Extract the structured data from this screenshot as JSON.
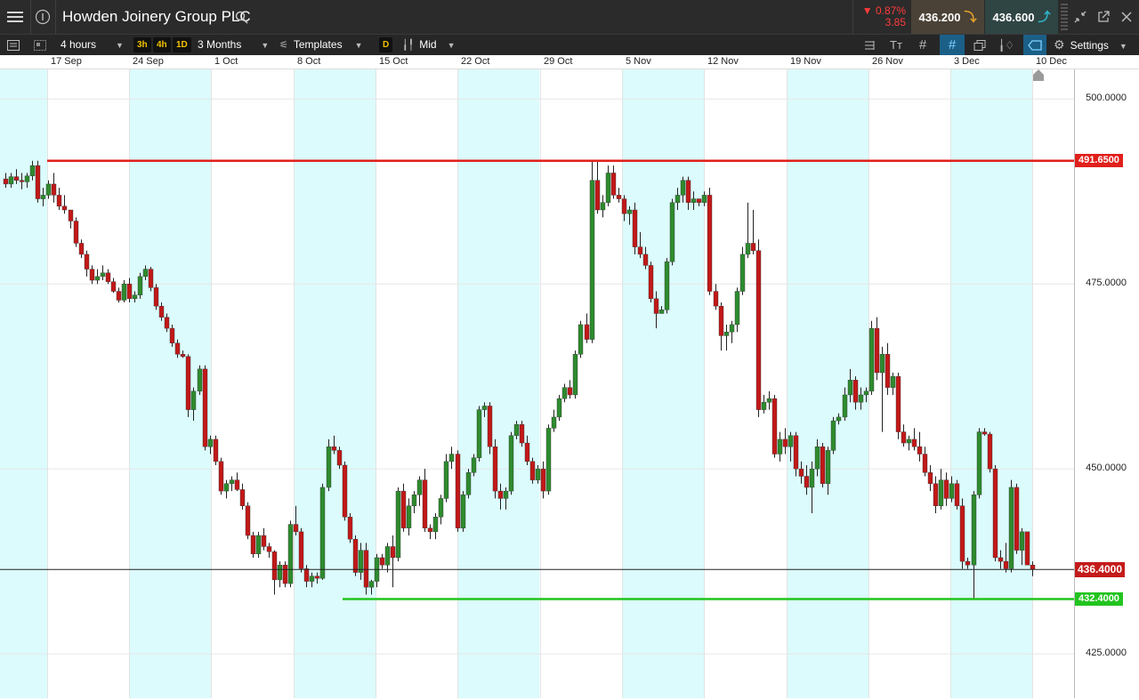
{
  "header": {
    "menu_icon": "hamburger-icon",
    "info_icon": "info-icon",
    "instrument_name": "Howden Joinery Group PLC",
    "change_percent": "▼ 0.87%",
    "change_value": "3.85",
    "sell_price": "436.200",
    "buy_price": "436.600",
    "window_icons": [
      "minimize-chart-icon",
      "popout-icon",
      "close-icon"
    ]
  },
  "toolbar": {
    "interval": "4 hours",
    "quick_intervals": [
      "3h",
      "4h",
      "1D"
    ],
    "range": "3 Months",
    "templates": "Templates",
    "d_badge": "D",
    "price_type": "Mid",
    "settings": "Settings"
  },
  "chart_data": {
    "type": "candlestick",
    "date_labels": [
      "17 Sep",
      "24 Sep",
      "1 Oct",
      "8 Oct",
      "15 Oct",
      "22 Oct",
      "29 Oct",
      "5 Nov",
      "12 Nov",
      "19 Nov",
      "26 Nov",
      "3 Dec",
      "10 Dec"
    ],
    "price_labels": [
      "500.0000",
      "475.0000",
      "450.0000",
      "425.0000"
    ],
    "price_ticks": [
      500,
      475,
      450,
      425
    ],
    "ylim": [
      419.0,
      504.0
    ],
    "resistance_line": {
      "value": 491.65,
      "label": "491.6500",
      "color": "#e0201b"
    },
    "support_line": {
      "value": 432.4,
      "label": "432.4000",
      "color": "#22c41f"
    },
    "current_price": {
      "value": 436.4,
      "label": "436.4000",
      "color": "#c41b1b"
    },
    "up_color": "#2e8b2e",
    "down_color": "#c21818",
    "shade_color": "#dcfbfc",
    "candles": [
      [
        489.2,
        490.0,
        488.0,
        488.5
      ],
      [
        488.5,
        490.0,
        488.0,
        489.5
      ],
      [
        489.5,
        490.5,
        488.5,
        489.0
      ],
      [
        489.0,
        490.0,
        487.8,
        488.8
      ],
      [
        488.8,
        490.0,
        488.0,
        489.6
      ],
      [
        489.6,
        491.65,
        489.0,
        491.0
      ],
      [
        491.0,
        491.65,
        486.0,
        486.5
      ],
      [
        486.5,
        488.0,
        485.5,
        487.0
      ],
      [
        487.0,
        489.0,
        486.5,
        488.5
      ],
      [
        488.5,
        490.0,
        486.0,
        487.0
      ],
      [
        487.0,
        488.0,
        485.0,
        485.5
      ],
      [
        485.5,
        487.0,
        484.5,
        485.0
      ],
      [
        485.0,
        484.5,
        482.5,
        483.5
      ],
      [
        483.5,
        484.0,
        480.0,
        480.5
      ],
      [
        480.5,
        481.0,
        478.5,
        479.0
      ],
      [
        479.0,
        479.5,
        476.0,
        477.0
      ],
      [
        477.0,
        477.5,
        475.0,
        475.5
      ],
      [
        475.5,
        477.0,
        475.0,
        476.0
      ],
      [
        476.0,
        477.5,
        475.5,
        476.5
      ],
      [
        476.5,
        477.0,
        475.0,
        475.3
      ],
      [
        475.3,
        475.8,
        473.8,
        474.0
      ],
      [
        474.0,
        474.5,
        472.5,
        472.8
      ],
      [
        472.8,
        475.5,
        472.5,
        475.0
      ],
      [
        475.0,
        475.8,
        472.5,
        473.0
      ],
      [
        473.0,
        474.0,
        472.5,
        473.5
      ],
      [
        473.5,
        476.5,
        473.0,
        476.0
      ],
      [
        476.0,
        477.5,
        475.5,
        477.0
      ],
      [
        477.0,
        477.3,
        474.0,
        474.5
      ],
      [
        474.5,
        475.0,
        471.5,
        472.0
      ],
      [
        472.0,
        472.5,
        470.0,
        470.5
      ],
      [
        470.5,
        471.0,
        468.5,
        469.0
      ],
      [
        469.0,
        469.5,
        466.5,
        467.0
      ],
      [
        467.0,
        467.5,
        465.0,
        465.5
      ],
      [
        465.5,
        466.0,
        465.0,
        465.2
      ],
      [
        465.2,
        465.5,
        457.0,
        458.0
      ],
      [
        458.0,
        461.0,
        456.5,
        460.5
      ],
      [
        460.5,
        464.0,
        460.0,
        463.5
      ],
      [
        463.5,
        464.0,
        452.5,
        453.0
      ],
      [
        453.0,
        454.5,
        452.0,
        454.0
      ],
      [
        454.0,
        454.5,
        450.5,
        451.0
      ],
      [
        451.0,
        451.5,
        446.5,
        447.0
      ],
      [
        447.0,
        448.5,
        446.0,
        448.0
      ],
      [
        448.0,
        449.0,
        447.0,
        448.5
      ],
      [
        448.5,
        449.5,
        447.0,
        447.2
      ],
      [
        447.2,
        448.0,
        444.5,
        445.0
      ],
      [
        445.0,
        445.5,
        440.5,
        441.0
      ],
      [
        441.0,
        441.5,
        438.0,
        438.5
      ],
      [
        438.5,
        441.5,
        438.0,
        441.0
      ],
      [
        441.0,
        442.0,
        439.0,
        439.5
      ],
      [
        439.5,
        440.0,
        438.0,
        438.8
      ],
      [
        438.8,
        439.0,
        433.0,
        435.0
      ],
      [
        435.0,
        437.5,
        434.0,
        437.0
      ],
      [
        437.0,
        437.5,
        434.0,
        434.5
      ],
      [
        434.5,
        443.0,
        434.0,
        442.5
      ],
      [
        442.5,
        445.0,
        441.0,
        441.5
      ],
      [
        441.5,
        442.0,
        436.0,
        436.5
      ],
      [
        436.5,
        437.0,
        434.0,
        434.8
      ],
      [
        434.8,
        436.0,
        434.0,
        435.5
      ],
      [
        435.5,
        436.0,
        434.5,
        435.2
      ],
      [
        435.2,
        448.0,
        435.0,
        447.5
      ],
      [
        447.5,
        454.0,
        447.0,
        453.0
      ],
      [
        453.0,
        454.5,
        452.0,
        452.5
      ],
      [
        452.5,
        453.0,
        450.0,
        450.5
      ],
      [
        450.5,
        451.0,
        443.0,
        443.5
      ],
      [
        443.5,
        444.0,
        440.0,
        440.5
      ],
      [
        440.5,
        441.0,
        435.5,
        436.0
      ],
      [
        436.0,
        440.0,
        435.0,
        439.0
      ],
      [
        439.0,
        440.0,
        433.0,
        434.0
      ],
      [
        434.0,
        435.0,
        433.0,
        434.8
      ],
      [
        434.8,
        438.5,
        434.0,
        438.0
      ],
      [
        438.0,
        438.5,
        436.5,
        437.0
      ],
      [
        437.0,
        440.0,
        436.0,
        439.5
      ],
      [
        439.5,
        441.0,
        434.0,
        438.0
      ],
      [
        438.0,
        447.5,
        437.5,
        447.0
      ],
      [
        447.0,
        448.0,
        441.5,
        442.0
      ],
      [
        442.0,
        446.0,
        441.0,
        445.0
      ],
      [
        445.0,
        447.0,
        444.0,
        446.5
      ],
      [
        446.5,
        449.0,
        445.0,
        448.5
      ],
      [
        448.5,
        450.0,
        441.5,
        442.0
      ],
      [
        442.0,
        442.5,
        440.5,
        441.5
      ],
      [
        441.5,
        444.0,
        440.5,
        443.5
      ],
      [
        443.5,
        446.5,
        442.5,
        446.0
      ],
      [
        446.0,
        452.0,
        445.5,
        451.0
      ],
      [
        451.0,
        453.0,
        450.0,
        452.0
      ],
      [
        452.0,
        452.5,
        441.5,
        442.0
      ],
      [
        442.0,
        447.0,
        441.5,
        446.5
      ],
      [
        446.5,
        450.0,
        446.0,
        449.5
      ],
      [
        449.5,
        452.0,
        449.0,
        451.5
      ],
      [
        451.5,
        458.5,
        451.0,
        458.0
      ],
      [
        458.0,
        459.0,
        457.0,
        458.5
      ],
      [
        458.5,
        459.0,
        452.0,
        453.0
      ],
      [
        453.0,
        454.0,
        446.0,
        447.0
      ],
      [
        447.0,
        448.0,
        444.5,
        446.0
      ],
      [
        446.0,
        447.5,
        444.5,
        447.0
      ],
      [
        447.0,
        455.0,
        446.5,
        454.5
      ],
      [
        454.5,
        456.5,
        454.0,
        456.0
      ],
      [
        456.0,
        456.5,
        453.0,
        453.5
      ],
      [
        453.5,
        454.5,
        450.5,
        451.0
      ],
      [
        451.0,
        451.5,
        448.0,
        448.5
      ],
      [
        448.5,
        450.5,
        448.0,
        450.0
      ],
      [
        450.0,
        451.0,
        446.0,
        447.0
      ],
      [
        447.0,
        456.0,
        446.5,
        455.5
      ],
      [
        455.5,
        458.0,
        455.0,
        457.0
      ],
      [
        457.0,
        460.0,
        456.5,
        459.5
      ],
      [
        459.5,
        461.5,
        459.0,
        461.0
      ],
      [
        461.0,
        462.0,
        459.5,
        460.0
      ],
      [
        460.0,
        466.0,
        459.5,
        465.5
      ],
      [
        465.5,
        470.0,
        465.0,
        469.5
      ],
      [
        469.5,
        471.0,
        467.0,
        467.5
      ],
      [
        467.5,
        491.5,
        467.0,
        489.0
      ],
      [
        489.0,
        491.5,
        484.5,
        485.0
      ],
      [
        485.0,
        487.0,
        484.0,
        486.0
      ],
      [
        486.0,
        491.0,
        485.5,
        490.0
      ],
      [
        490.0,
        491.0,
        486.5,
        487.0
      ],
      [
        487.0,
        488.0,
        486.0,
        486.5
      ],
      [
        486.5,
        487.0,
        483.5,
        484.5
      ],
      [
        484.5,
        485.5,
        483.0,
        485.0
      ],
      [
        485.0,
        486.0,
        479.0,
        480.0
      ],
      [
        480.0,
        482.0,
        478.5,
        479.0
      ],
      [
        479.0,
        480.0,
        477.0,
        477.5
      ],
      [
        477.5,
        478.0,
        472.5,
        473.0
      ],
      [
        473.0,
        474.0,
        469.0,
        471.0
      ],
      [
        471.0,
        472.0,
        471.0,
        471.5
      ],
      [
        471.5,
        478.5,
        471.0,
        478.0
      ],
      [
        478.0,
        486.5,
        477.5,
        486.0
      ],
      [
        486.0,
        488.0,
        485.0,
        487.0
      ],
      [
        487.0,
        489.5,
        486.0,
        489.0
      ],
      [
        489.0,
        489.5,
        485.0,
        486.0
      ],
      [
        486.0,
        487.5,
        485.0,
        486.5
      ],
      [
        486.5,
        486.5,
        485.5,
        486.0
      ],
      [
        486.0,
        487.5,
        485.5,
        487.0
      ],
      [
        487.0,
        488.0,
        473.5,
        474.0
      ],
      [
        474.0,
        475.0,
        471.5,
        472.0
      ],
      [
        472.0,
        472.5,
        466.0,
        468.0
      ],
      [
        468.0,
        469.5,
        466.0,
        468.5
      ],
      [
        468.5,
        470.0,
        467.0,
        469.5
      ],
      [
        469.5,
        474.5,
        468.5,
        474.0
      ],
      [
        474.0,
        480.0,
        473.5,
        479.0
      ],
      [
        479.0,
        486.0,
        478.5,
        480.5
      ],
      [
        480.5,
        485.0,
        479.0,
        479.5
      ],
      [
        479.5,
        481.0,
        457.0,
        458.0
      ],
      [
        458.0,
        460.0,
        457.5,
        459.0
      ],
      [
        459.0,
        460.5,
        458.0,
        459.5
      ],
      [
        459.5,
        460.0,
        451.5,
        452.0
      ],
      [
        452.0,
        455.0,
        451.0,
        454.0
      ],
      [
        454.0,
        455.5,
        452.0,
        453.0
      ],
      [
        453.0,
        455.0,
        451.0,
        454.5
      ],
      [
        454.5,
        455.0,
        449.0,
        450.0
      ],
      [
        450.0,
        451.0,
        448.0,
        449.0
      ],
      [
        449.0,
        450.5,
        446.5,
        447.5
      ],
      [
        447.5,
        451.0,
        444.0,
        450.0
      ],
      [
        450.0,
        454.0,
        449.0,
        453.0
      ],
      [
        453.0,
        453.5,
        447.5,
        448.0
      ],
      [
        448.0,
        453.0,
        446.5,
        452.5
      ],
      [
        452.5,
        457.0,
        452.0,
        456.5
      ],
      [
        456.5,
        457.5,
        456.0,
        457.0
      ],
      [
        457.0,
        461.0,
        456.5,
        460.0
      ],
      [
        460.0,
        463.5,
        459.0,
        462.0
      ],
      [
        462.0,
        462.5,
        458.0,
        459.0
      ],
      [
        459.0,
        461.0,
        458.0,
        460.0
      ],
      [
        460.0,
        461.0,
        459.0,
        460.5
      ],
      [
        460.5,
        470.0,
        460.0,
        469.0
      ],
      [
        469.0,
        470.5,
        462.0,
        463.0
      ],
      [
        463.0,
        466.5,
        455.0,
        465.5
      ],
      [
        465.5,
        467.0,
        460.0,
        461.0
      ],
      [
        461.0,
        463.0,
        460.0,
        462.5
      ],
      [
        462.5,
        463.0,
        454.0,
        455.0
      ],
      [
        455.0,
        456.0,
        453.0,
        453.5
      ],
      [
        453.5,
        454.5,
        452.5,
        454.0
      ],
      [
        454.0,
        455.5,
        452.5,
        453.0
      ],
      [
        453.0,
        455.0,
        451.0,
        452.0
      ],
      [
        452.0,
        453.0,
        449.0,
        449.5
      ],
      [
        449.5,
        450.5,
        447.0,
        448.0
      ],
      [
        448.0,
        449.0,
        444.0,
        445.0
      ],
      [
        445.0,
        450.0,
        444.5,
        448.5
      ],
      [
        448.5,
        449.5,
        445.0,
        446.0
      ],
      [
        446.0,
        449.0,
        445.5,
        448.0
      ],
      [
        448.0,
        448.5,
        444.5,
        445.0
      ],
      [
        445.0,
        446.0,
        436.5,
        437.5
      ],
      [
        437.5,
        438.0,
        436.5,
        437.0
      ],
      [
        437.0,
        447.0,
        432.5,
        446.5
      ],
      [
        446.5,
        455.5,
        446.0,
        455.0
      ],
      [
        455.0,
        455.5,
        454.5,
        454.7
      ],
      [
        454.7,
        455.0,
        449.5,
        450.0
      ],
      [
        450.0,
        450.5,
        437.5,
        438.0
      ],
      [
        438.0,
        439.0,
        436.5,
        437.5
      ],
      [
        437.5,
        440.0,
        436.0,
        436.5
      ],
      [
        436.5,
        448.5,
        436.0,
        447.5
      ],
      [
        447.5,
        448.0,
        438.5,
        439.0
      ],
      [
        439.0,
        442.0,
        437.0,
        441.5
      ],
      [
        441.5,
        441.5,
        437.0,
        437.0
      ],
      [
        437.0,
        437.5,
        435.5,
        436.4
      ]
    ]
  }
}
